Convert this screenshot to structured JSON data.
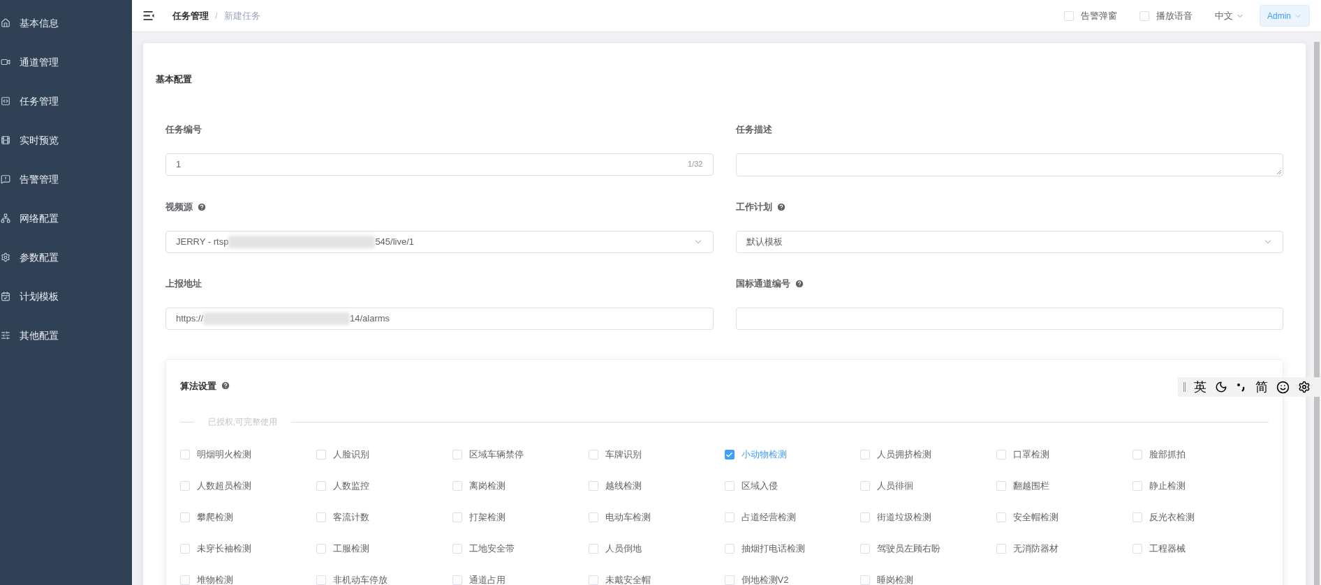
{
  "sidebar": {
    "items": [
      {
        "label": "基本信息",
        "selected": false
      },
      {
        "label": "通道管理",
        "selected": false
      },
      {
        "label": "任务管理",
        "selected": false
      },
      {
        "label": "实时预览",
        "selected": false
      },
      {
        "label": "告警管理",
        "selected": false
      },
      {
        "label": "网络配置",
        "selected": false
      },
      {
        "label": "参数配置",
        "selected": false
      },
      {
        "label": "计划模板",
        "selected": false
      },
      {
        "label": "其他配置",
        "selected": false
      }
    ]
  },
  "header": {
    "breadcrumb": [
      {
        "label": "任务管理",
        "current": false
      },
      {
        "label": "新建任务",
        "current": true
      }
    ],
    "breadcrumb_separator": "/",
    "toggles": [
      {
        "label": "告警弹窗",
        "checked": false
      },
      {
        "label": "播放语音",
        "checked": false
      }
    ],
    "language": "中文",
    "user": "Admin"
  },
  "form": {
    "section_title": "基本配置",
    "fields": [
      {
        "label": "任务编号",
        "kind": "input",
        "help": false,
        "value": "1",
        "counter": "1/32"
      },
      {
        "label": "任务描述",
        "kind": "textarea",
        "help": false
      },
      {
        "label": "视频源",
        "kind": "select",
        "help": true,
        "value": "JERRY - rtsp",
        "value_suffix": "545/live/1",
        "redacted": true
      },
      {
        "label": "工作计划",
        "kind": "select",
        "help": true,
        "value": "默认模板"
      },
      {
        "label": "上报地址",
        "kind": "input",
        "help": false,
        "value": "https://",
        "value_suffix": "14/alarms",
        "redacted": true
      },
      {
        "label": "国标通道编号",
        "kind": "input",
        "help": true
      }
    ]
  },
  "algorithms": {
    "title": "算法设置",
    "help": true,
    "divider_label": "已授权,可完整使用",
    "items": [
      {
        "label": "明烟明火检测",
        "checked": false
      },
      {
        "label": "人脸识别",
        "checked": false
      },
      {
        "label": "区域车辆禁停",
        "checked": false
      },
      {
        "label": "车牌识别",
        "checked": false
      },
      {
        "label": "小动物检测",
        "checked": true
      },
      {
        "label": "人员拥挤检测",
        "checked": false
      },
      {
        "label": "口罩检测",
        "checked": false
      },
      {
        "label": "脸部抓拍",
        "checked": false
      },
      {
        "label": "人数超员检测",
        "checked": false
      },
      {
        "label": "人数监控",
        "checked": false
      },
      {
        "label": "离岗检测",
        "checked": false
      },
      {
        "label": "越线检测",
        "checked": false
      },
      {
        "label": "区域入侵",
        "checked": false
      },
      {
        "label": "人员徘徊",
        "checked": false
      },
      {
        "label": "翻越围栏",
        "checked": false
      },
      {
        "label": "静止检测",
        "checked": false
      },
      {
        "label": "攀爬检测",
        "checked": false
      },
      {
        "label": "客流计数",
        "checked": false
      },
      {
        "label": "打架检测",
        "checked": false
      },
      {
        "label": "电动车检测",
        "checked": false
      },
      {
        "label": "占道经营检测",
        "checked": false
      },
      {
        "label": "街道垃圾检测",
        "checked": false
      },
      {
        "label": "安全帽检测",
        "checked": false
      },
      {
        "label": "反光衣检测",
        "checked": false
      },
      {
        "label": "未穿长袖检测",
        "checked": false
      },
      {
        "label": "工服检测",
        "checked": false
      },
      {
        "label": "工地安全带",
        "checked": false
      },
      {
        "label": "人员倒地",
        "checked": false
      },
      {
        "label": "抽烟打电话检测",
        "checked": false
      },
      {
        "label": "驾驶员左顾右盼",
        "checked": false
      },
      {
        "label": "无消防器材",
        "checked": false
      },
      {
        "label": "工程器械",
        "checked": false
      },
      {
        "label": "堆物检测",
        "checked": false
      },
      {
        "label": "非机动车停放",
        "checked": false
      },
      {
        "label": "通道占用",
        "checked": false
      },
      {
        "label": "未戴安全帽",
        "checked": false
      },
      {
        "label": "倒地检测V2",
        "checked": false
      },
      {
        "label": "睡岗检测",
        "checked": false
      }
    ]
  },
  "ime_toolbar": {
    "items": [
      {
        "kind": "text",
        "label": "英"
      },
      {
        "kind": "moon"
      },
      {
        "kind": "punct"
      },
      {
        "kind": "text",
        "label": "简"
      },
      {
        "kind": "smile"
      },
      {
        "kind": "gear"
      }
    ]
  }
}
